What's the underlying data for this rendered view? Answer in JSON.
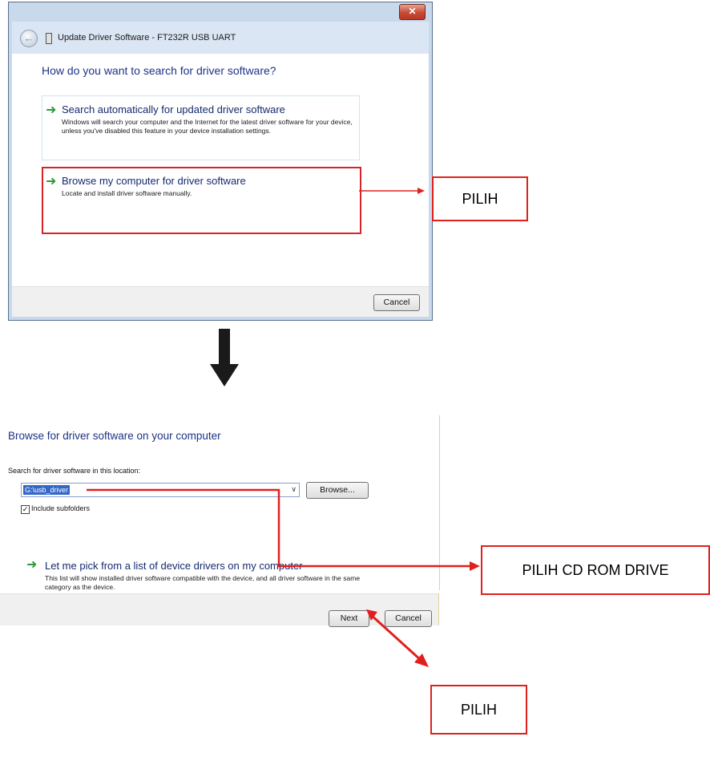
{
  "dialog1": {
    "title": "Update Driver Software - FT232R USB UART",
    "close_label": "✕",
    "heading": "How do you want to search for driver software?",
    "option_auto": {
      "title": "Search automatically for updated driver software",
      "description": "Windows will search your computer and the Internet for the latest driver software for your device, unless you've disabled this feature in your device installation settings."
    },
    "option_browse": {
      "title": "Browse my computer for driver software",
      "description": "Locate and install driver software manually."
    },
    "cancel_label": "Cancel"
  },
  "dialog2": {
    "heading": "Browse for driver software on your computer",
    "location_label": "Search for driver software in this location:",
    "location_value": "G:\\usb_driver",
    "browse_label": "Browse...",
    "include_subfolders_label": "Include subfolders",
    "include_subfolders_checked": true,
    "pick_option": {
      "title": "Let me pick from a list of device drivers on my computer",
      "description": "This list will show installed driver software compatible with the device, and all driver software in the same category as the device."
    },
    "next_label": "Next",
    "cancel_label": "Cancel"
  },
  "callouts": {
    "pilih_browse": "PILIH",
    "pilih_cdrom": "PILIH CD ROM DRIVE",
    "pilih_next": "PILIH"
  },
  "colors": {
    "accent_red": "#e0201d",
    "heading_blue": "#1e3287",
    "arrow_green": "#2e9a3a"
  }
}
